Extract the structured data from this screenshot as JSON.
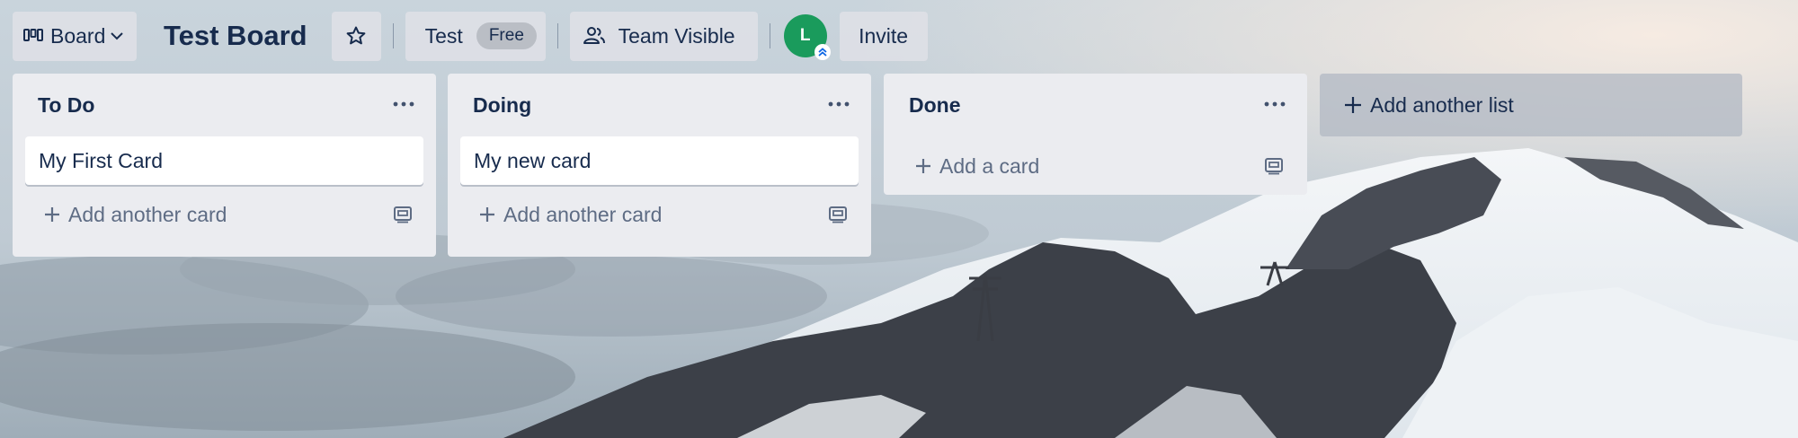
{
  "header": {
    "view_switcher_label": "Board",
    "board_title": "Test Board",
    "workspace_label": "Test",
    "workspace_badge": "Free",
    "visibility_label": "Team Visible",
    "avatar_initial": "L",
    "invite_label": "Invite",
    "avatar_color": "#1a9b5c"
  },
  "lists": [
    {
      "title": "To Do",
      "cards": [
        "My First Card"
      ],
      "composer_label": "Add another card"
    },
    {
      "title": "Doing",
      "cards": [
        "My new card"
      ],
      "composer_label": "Add another card"
    },
    {
      "title": "Done",
      "cards": [],
      "composer_label": "Add a card"
    }
  ],
  "add_list_label": "Add another list",
  "icons": {
    "view_switcher": "board-icon",
    "star": "star-icon",
    "visibility": "team-icon",
    "list_menu": "more-horizontal-icon",
    "add": "plus-icon",
    "template": "card-template-icon"
  }
}
